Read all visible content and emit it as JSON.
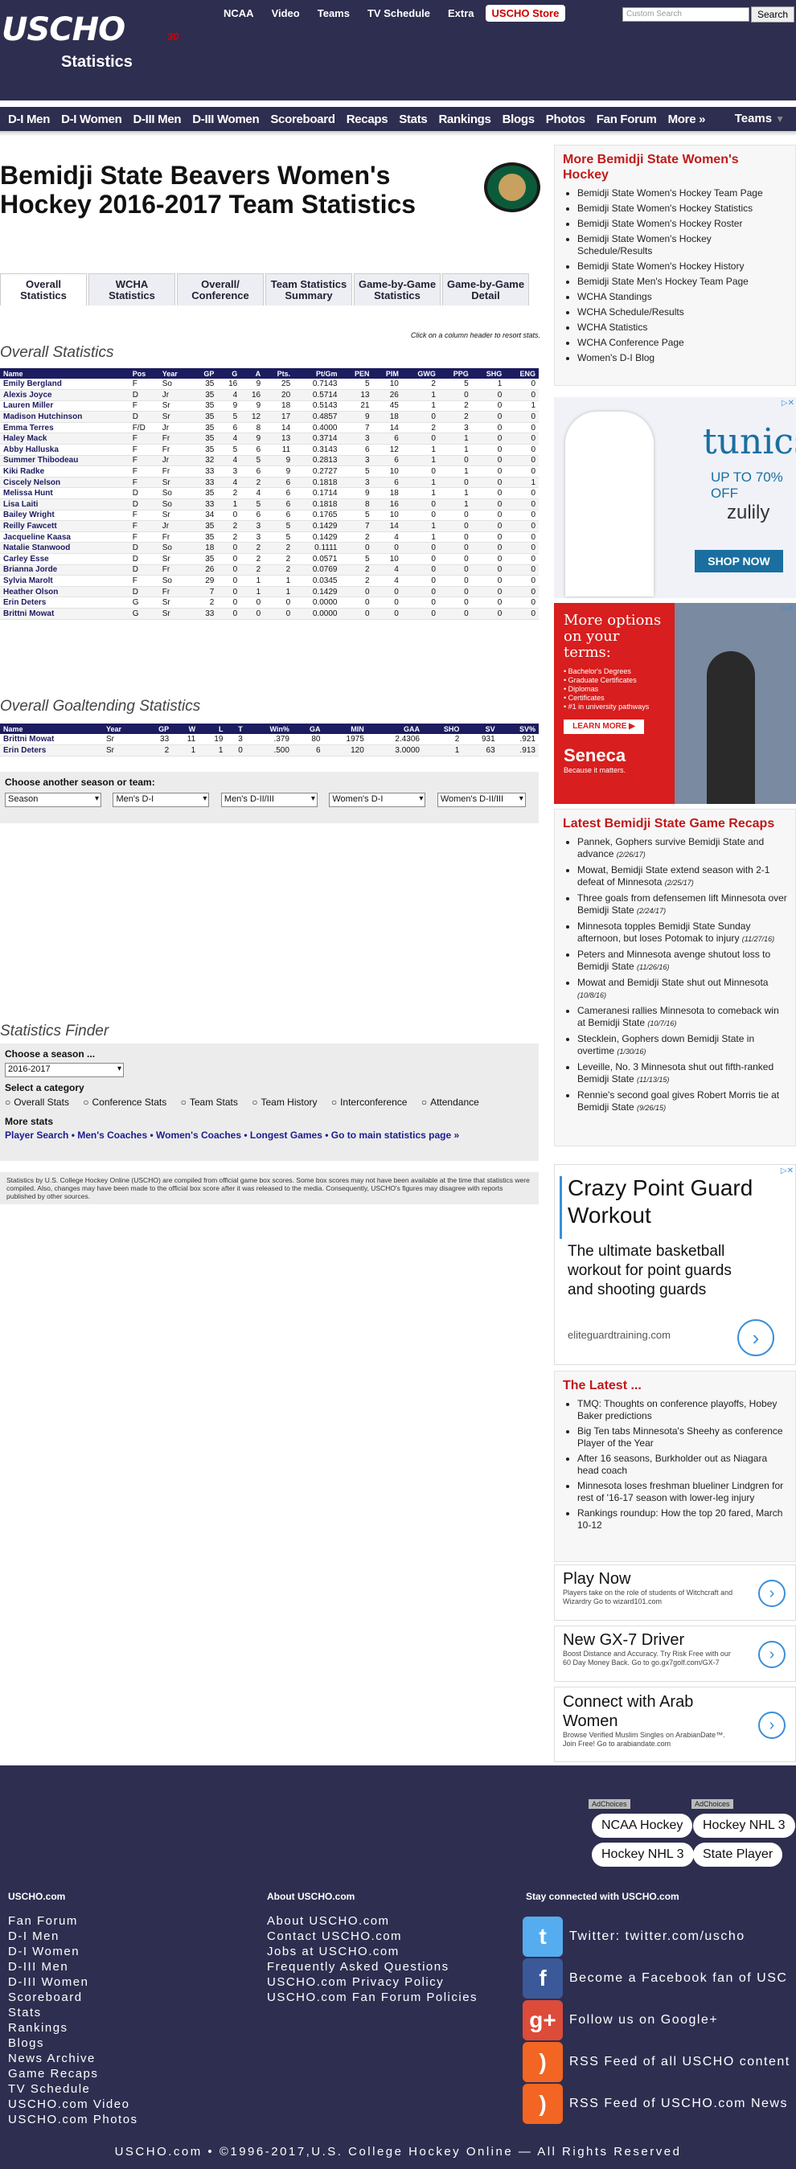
{
  "header": {
    "logo": "USCHO",
    "logo_sub": "30",
    "section_title": "Statistics",
    "topnav": [
      "NCAA",
      "Video",
      "Teams",
      "TV Schedule",
      "Extra",
      "USCHO Store"
    ],
    "search_placeholder": "Custom Search",
    "search_button": "Search",
    "mainnav": [
      "D-I Men",
      "D-I Women",
      "D-III Men",
      "D-III Women",
      "Scoreboard",
      "Recaps",
      "Stats",
      "Rankings",
      "Blogs",
      "Photos",
      "Fan Forum",
      "More »"
    ],
    "teams_nav": "Teams"
  },
  "page": {
    "title": "Bemidji State Beavers Women's Hockey 2016-2017 Team Statistics",
    "tabs": [
      "Overall Statistics",
      "WCHA Statistics",
      "Overall/ Conference",
      "Team Statistics Summary",
      "Game-by-Game Statistics",
      "Game-by-Game Detail"
    ],
    "sort_hint": "Click on a column header to resort stats.",
    "overall_heading": "Overall Statistics",
    "goalie_heading": "Overall Goaltending Statistics",
    "choose_label": "Choose another season or team:",
    "selects": [
      "Season",
      "Men's D-I",
      "Men's D-II/III",
      "Women's D-I",
      "Women's D-II/III"
    ],
    "finder_heading": "Statistics Finder",
    "choose_season_label": "Choose a season ...",
    "season_value": "2016-2017",
    "category_label": "Select a category",
    "categories": [
      "Overall Stats",
      "Conference Stats",
      "Team Stats",
      "Team History",
      "Interconference",
      "Attendance"
    ],
    "more_stats_label": "More stats",
    "more_stats_links": "Player Search • Men's Coaches • Women's Coaches • Longest Games • Go to main statistics page »",
    "disclaimer": "Statistics by U.S. College Hockey Online (USCHO) are compiled from official game box scores. Some box scores may not have been available at the time that statistics were compiled. Also, changes may have been made to the official box score after it was released to the media. Consequently, USCHO's figures may disagree with reports published by other sources."
  },
  "skaters": {
    "headers": [
      "Name",
      "Pos",
      "Year",
      "GP",
      "G",
      "A",
      "Pts.",
      "Pt/Gm",
      "PEN",
      "PIM",
      "GWG",
      "PPG",
      "SHG",
      "ENG"
    ],
    "rows": [
      [
        "Emily Bergland",
        "F",
        "So",
        "35",
        "16",
        "9",
        "25",
        "0.7143",
        "5",
        "10",
        "2",
        "5",
        "1",
        "0"
      ],
      [
        "Alexis Joyce",
        "D",
        "Jr",
        "35",
        "4",
        "16",
        "20",
        "0.5714",
        "13",
        "26",
        "1",
        "0",
        "0",
        "0"
      ],
      [
        "Lauren Miller",
        "F",
        "Sr",
        "35",
        "9",
        "9",
        "18",
        "0.5143",
        "21",
        "45",
        "1",
        "2",
        "0",
        "1"
      ],
      [
        "Madison Hutchinson",
        "D",
        "Sr",
        "35",
        "5",
        "12",
        "17",
        "0.4857",
        "9",
        "18",
        "0",
        "2",
        "0",
        "0"
      ],
      [
        "Emma Terres",
        "F/D",
        "Jr",
        "35",
        "6",
        "8",
        "14",
        "0.4000",
        "7",
        "14",
        "2",
        "3",
        "0",
        "0"
      ],
      [
        "Haley Mack",
        "F",
        "Fr",
        "35",
        "4",
        "9",
        "13",
        "0.3714",
        "3",
        "6",
        "0",
        "1",
        "0",
        "0"
      ],
      [
        "Abby Halluska",
        "F",
        "Fr",
        "35",
        "5",
        "6",
        "11",
        "0.3143",
        "6",
        "12",
        "1",
        "1",
        "0",
        "0"
      ],
      [
        "Summer Thibodeau",
        "F",
        "Jr",
        "32",
        "4",
        "5",
        "9",
        "0.2813",
        "3",
        "6",
        "1",
        "0",
        "0",
        "0"
      ],
      [
        "Kiki Radke",
        "F",
        "Fr",
        "33",
        "3",
        "6",
        "9",
        "0.2727",
        "5",
        "10",
        "0",
        "1",
        "0",
        "0"
      ],
      [
        "Ciscely Nelson",
        "F",
        "Sr",
        "33",
        "4",
        "2",
        "6",
        "0.1818",
        "3",
        "6",
        "1",
        "0",
        "0",
        "1"
      ],
      [
        "Melissa Hunt",
        "D",
        "So",
        "35",
        "2",
        "4",
        "6",
        "0.1714",
        "9",
        "18",
        "1",
        "1",
        "0",
        "0"
      ],
      [
        "Lisa Laiti",
        "D",
        "So",
        "33",
        "1",
        "5",
        "6",
        "0.1818",
        "8",
        "16",
        "0",
        "1",
        "0",
        "0"
      ],
      [
        "Bailey Wright",
        "F",
        "Sr",
        "34",
        "0",
        "6",
        "6",
        "0.1765",
        "5",
        "10",
        "0",
        "0",
        "0",
        "0"
      ],
      [
        "Reilly Fawcett",
        "F",
        "Jr",
        "35",
        "2",
        "3",
        "5",
        "0.1429",
        "7",
        "14",
        "1",
        "0",
        "0",
        "0"
      ],
      [
        "Jacqueline Kaasa",
        "F",
        "Fr",
        "35",
        "2",
        "3",
        "5",
        "0.1429",
        "2",
        "4",
        "1",
        "0",
        "0",
        "0"
      ],
      [
        "Natalie Stanwood",
        "D",
        "So",
        "18",
        "0",
        "2",
        "2",
        "0.1111",
        "0",
        "0",
        "0",
        "0",
        "0",
        "0"
      ],
      [
        "Carley Esse",
        "D",
        "Sr",
        "35",
        "0",
        "2",
        "2",
        "0.0571",
        "5",
        "10",
        "0",
        "0",
        "0",
        "0"
      ],
      [
        "Brianna Jorde",
        "D",
        "Fr",
        "26",
        "0",
        "2",
        "2",
        "0.0769",
        "2",
        "4",
        "0",
        "0",
        "0",
        "0"
      ],
      [
        "Sylvia Marolt",
        "F",
        "So",
        "29",
        "0",
        "1",
        "1",
        "0.0345",
        "2",
        "4",
        "0",
        "0",
        "0",
        "0"
      ],
      [
        "Heather Olson",
        "D",
        "Fr",
        "7",
        "0",
        "1",
        "1",
        "0.1429",
        "0",
        "0",
        "0",
        "0",
        "0",
        "0"
      ],
      [
        "Erin Deters",
        "G",
        "Sr",
        "2",
        "0",
        "0",
        "0",
        "0.0000",
        "0",
        "0",
        "0",
        "0",
        "0",
        "0"
      ],
      [
        "Brittni Mowat",
        "G",
        "Sr",
        "33",
        "0",
        "0",
        "0",
        "0.0000",
        "0",
        "0",
        "0",
        "0",
        "0",
        "0"
      ]
    ]
  },
  "goalies": {
    "headers": [
      "Name",
      "Year",
      "GP",
      "W",
      "L",
      "T",
      "Win%",
      "GA",
      "MIN",
      "GAA",
      "SHO",
      "SV",
      "SV%"
    ],
    "rows": [
      [
        "Brittni Mowat",
        "Sr",
        "33",
        "11",
        "19",
        "3",
        ".379",
        "80",
        "1975",
        "2.4306",
        "2",
        "931",
        ".921"
      ],
      [
        "Erin Deters",
        "Sr",
        "2",
        "1",
        "1",
        "0",
        ".500",
        "6",
        "120",
        "3.0000",
        "1",
        "63",
        ".913"
      ]
    ]
  },
  "sidebar": {
    "more_heading": "More Bemidji State Women's Hockey",
    "more_links": [
      "Bemidji State Women's Hockey Team Page",
      "Bemidji State Women's Hockey Statistics",
      "Bemidji State Women's Hockey Roster",
      "Bemidji State Women's Hockey Schedule/Results",
      "Bemidji State Women's Hockey History",
      "Bemidji State Men's Hockey Team Page",
      "WCHA Standings",
      "WCHA Schedule/Results",
      "WCHA Statistics",
      "WCHA Conference Page",
      "Women's D-I Blog"
    ],
    "recaps_heading": "Latest Bemidji State Game Recaps",
    "recaps": [
      {
        "text": "Pannek, Gophers survive Bemidji State and advance",
        "date": "(2/26/17)"
      },
      {
        "text": "Mowat, Bemidji State extend season with 2-1 defeat of Minnesota",
        "date": "(2/25/17)"
      },
      {
        "text": "Three goals from defensemen lift Minnesota over Bemidji State",
        "date": "(2/24/17)"
      },
      {
        "text": "Minnesota topples Bemidji State Sunday afternoon, but loses Potomak to injury",
        "date": "(11/27/16)"
      },
      {
        "text": "Peters and Minnesota avenge shutout loss to Bemidji State",
        "date": "(11/26/16)"
      },
      {
        "text": "Mowat and Bemidji State shut out Minnesota",
        "date": "(10/8/16)"
      },
      {
        "text": "Cameranesi rallies Minnesota to comeback win at Bemidji State",
        "date": "(10/7/16)"
      },
      {
        "text": "Stecklein, Gophers down Bemidji State in overtime",
        "date": "(1/30/16)"
      },
      {
        "text": "Leveille, No. 3 Minnesota shut out fifth-ranked Bemidji State",
        "date": "(11/13/15)"
      },
      {
        "text": "Rennie's second goal gives Robert Morris tie at Bemidji State",
        "date": "(9/26/15)"
      }
    ],
    "latest_heading": "The Latest ...",
    "latest": [
      "TMQ: Thoughts on conference playoffs, Hobey Baker predictions",
      "Big Ten tabs Minnesota's Sheehy as conference Player of the Year",
      "After 16 seasons, Burkholder out as Niagara head coach",
      "Minnesota loses freshman blueliner Lindgren for rest of '16-17 season with lower-leg injury",
      "Rankings roundup: How the top 20 fared, March 10-12"
    ]
  },
  "ads": {
    "tunics_title": "tunics",
    "tunics_sub": "UP TO 70% OFF",
    "tunics_brand": "zulily",
    "tunics_cta": "SHOP NOW",
    "seneca_title": "More options on your terms:",
    "seneca_items": [
      "• Bachelor's Degrees",
      "• Graduate Certificates",
      "• Diplomas",
      "• Certificates",
      "• #1 in university pathways"
    ],
    "seneca_cta": "LEARN MORE ▶",
    "seneca_brand": "Seneca",
    "seneca_tag": "Because it matters.",
    "crazy_title": "Crazy Point Guard Workout",
    "crazy_desc": "The ultimate basketball workout for point guards and shooting guards",
    "crazy_url": "eliteguardtraining.com",
    "small": [
      {
        "title": "Play Now",
        "desc": "Players take on the role of students of Witchcraft and Wizardry Go to wizard101.com"
      },
      {
        "title": "New GX-7 Driver",
        "desc": "Boost Distance and Accuracy. Try Risk Free with our 60 Day Money Back. Go to go.gx7golf.com/GX-7"
      },
      {
        "title": "Connect with Arab Women",
        "desc": "Browse Verified Muslim Singles on ArabianDate™. Join Free! Go to arabiandate.com"
      }
    ]
  },
  "footer": {
    "adchoices": "AdChoices",
    "pills": [
      "NCAA Hockey",
      "Hockey NHL 3",
      "Hockey NHL 3",
      "State Player"
    ],
    "col1_heading": "USCHO.com",
    "col1_links": [
      "Fan Forum",
      "D-I Men",
      "D-I Women",
      "D-III Men",
      "D-III Women",
      "Scoreboard",
      "Stats",
      "Rankings",
      "Blogs",
      "News Archive",
      "Game Recaps",
      "TV Schedule",
      "USCHO.com Video",
      "USCHO.com Photos"
    ],
    "col2_heading": "About USCHO.com",
    "col2_links": [
      "About USCHO.com",
      "Contact USCHO.com",
      "Jobs at USCHO.com",
      "Frequently Asked Questions",
      "USCHO.com Privacy Policy",
      "USCHO.com Fan Forum Policies"
    ],
    "col3_heading": "Stay connected with USCHO.com",
    "social": [
      {
        "text": "Twitter: twitter.com/uscho",
        "color": "#55acee",
        "glyph": "t"
      },
      {
        "text": "Become a Facebook fan of USC",
        "color": "#3b5998",
        "glyph": "f"
      },
      {
        "text": "Follow us on Google+",
        "color": "#dd4b39",
        "glyph": "g+"
      },
      {
        "text": "RSS Feed of all USCHO content",
        "color": "#f26522",
        "glyph": ")"
      },
      {
        "text": "RSS Feed of USCHO.com News",
        "color": "#f26522",
        "glyph": ")"
      }
    ],
    "copyright": "USCHO.com • ©1996-2017,U.S. College Hockey Online — All Rights Reserved"
  }
}
